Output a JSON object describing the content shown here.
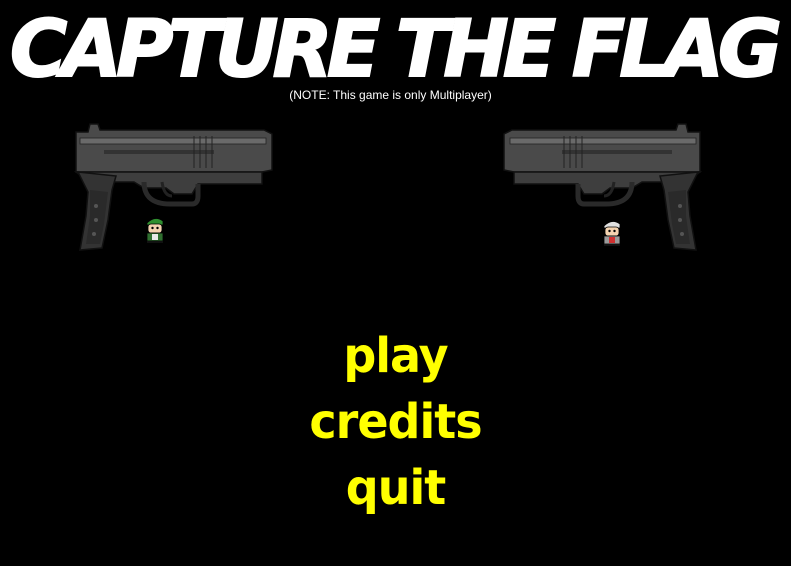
{
  "game": {
    "title": "CAPTURE THE FLAG",
    "note": "(NOTE: This game is only Multiplayer)"
  },
  "menu": {
    "items": [
      {
        "label": "play"
      },
      {
        "label": "credits"
      },
      {
        "label": "quit"
      }
    ]
  },
  "colors": {
    "background": "#000000",
    "title": "#ffffff",
    "menu": "#ffff00",
    "gun_body": "#3a3a3a",
    "gun_slide": "#555555"
  },
  "decorations": {
    "left_gun": "pistol-icon",
    "right_gun": "pistol-icon",
    "left_player": "green-soldier-sprite",
    "right_player": "white-soldier-sprite"
  }
}
